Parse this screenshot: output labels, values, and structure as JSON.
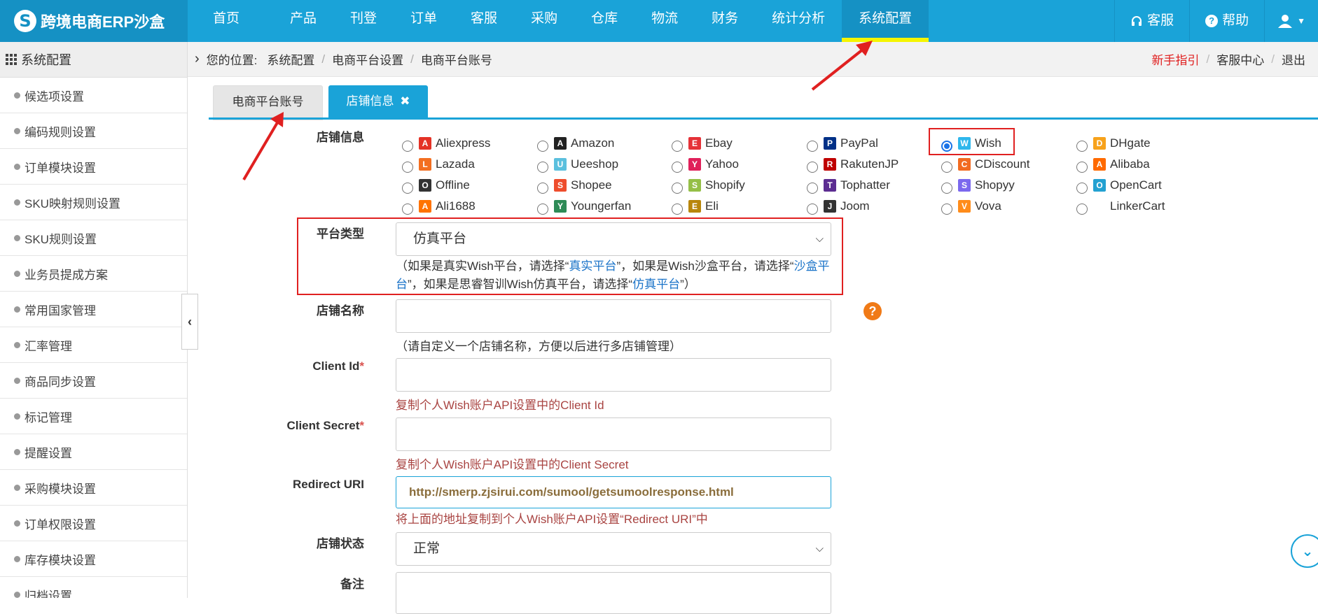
{
  "brand": {
    "logo_letter": "S",
    "name": "跨境电商ERP沙盒"
  },
  "topnav": {
    "items": [
      "首页",
      "产品",
      "刊登",
      "订单",
      "客服",
      "采购",
      "仓库",
      "物流",
      "财务",
      "统计分析",
      "系统配置"
    ],
    "active_index": 10,
    "right": {
      "service": "客服",
      "help": "帮助"
    }
  },
  "sidebar": {
    "title": "系统配置",
    "items": [
      "候选项设置",
      "编码规则设置",
      "订单模块设置",
      "SKU映射规则设置",
      "SKU规则设置",
      "业务员提成方案",
      "常用国家管理",
      "汇率管理",
      "商品同步设置",
      "标记管理",
      "提醒设置",
      "采购模块设置",
      "订单权限设置",
      "库存模块设置",
      "归档设置"
    ]
  },
  "breadcrumb": {
    "prefix": "您的位置:",
    "items": [
      "系统配置",
      "电商平台设置",
      "电商平台账号"
    ],
    "links": {
      "guide": "新手指引",
      "service_center": "客服中心",
      "logout": "退出"
    }
  },
  "tabs": {
    "tab1": "电商平台账号",
    "tab2": "店铺信息",
    "tab2_close": "✖"
  },
  "form": {
    "store_info_label": "店铺信息",
    "platforms": [
      {
        "name": "Aliexpress",
        "icon": "aliexpress-icon",
        "color": "#e43226"
      },
      {
        "name": "Amazon",
        "icon": "amazon-icon",
        "color": "#222222"
      },
      {
        "name": "Ebay",
        "icon": "ebay-icon",
        "color": "#e53238"
      },
      {
        "name": "PayPal",
        "icon": "paypal-icon",
        "color": "#003087"
      },
      {
        "name": "Wish",
        "icon": "wish-icon",
        "color": "#2fb7ec"
      },
      {
        "name": "DHgate",
        "icon": "dhgate-icon",
        "color": "#f7a21b"
      },
      {
        "name": "Lazada",
        "icon": "lazada-icon",
        "color": "#f36f21"
      },
      {
        "name": "Ueeshop",
        "icon": "ueeshop-icon",
        "color": "#5bc0de"
      },
      {
        "name": "Yahoo",
        "icon": "yahoo-icon",
        "color": "#e0205a"
      },
      {
        "name": "RakutenJP",
        "icon": "rakuten-icon",
        "color": "#bf0000"
      },
      {
        "name": "CDiscount",
        "icon": "cdiscount-icon",
        "color": "#f26b21"
      },
      {
        "name": "Alibaba",
        "icon": "alibaba-icon",
        "color": "#ff6a00"
      },
      {
        "name": "Offline",
        "icon": "offline-icon",
        "color": "#333333"
      },
      {
        "name": "Shopee",
        "icon": "shopee-icon",
        "color": "#ee4d2d"
      },
      {
        "name": "Shopify",
        "icon": "shopify-icon",
        "color": "#95bf47"
      },
      {
        "name": "Tophatter",
        "icon": "tophatter-icon",
        "color": "#5c2d91"
      },
      {
        "name": "Shopyy",
        "icon": "shopyy-icon",
        "color": "#7b68ee"
      },
      {
        "name": "OpenCart",
        "icon": "opencart-icon",
        "color": "#23a1d1"
      },
      {
        "name": "Ali1688",
        "icon": "ali1688-icon",
        "color": "#ff7300"
      },
      {
        "name": "Youngerfan",
        "icon": "youngerfan-icon",
        "color": "#2e8b57"
      },
      {
        "name": "Eli",
        "icon": "eli-icon",
        "color": "#b8860b"
      },
      {
        "name": "Joom",
        "icon": "joom-icon",
        "color": "#333333"
      },
      {
        "name": "Vova",
        "icon": "vova-icon",
        "color": "#ff8c1a"
      },
      {
        "name": "LinkerCart",
        "icon": "",
        "color": ""
      }
    ],
    "selected_platform": "Wish",
    "platform_type_label": "平台类型",
    "platform_type_value": "仿真平台",
    "platform_type_hint": {
      "p1": "（如果是真实Wish平台，请选择“",
      "l1": "真实平台",
      "p2": "”，如果是Wish沙盒平台，请选择“",
      "l2": "沙盒平台",
      "p3": "”，如果是思睿智训Wish仿真平台，请选择“",
      "l3": "仿真平台",
      "p4": "”）"
    },
    "store_name_label": "店铺名称",
    "store_name_value": "",
    "store_name_hint": "（请自定义一个店铺名称，方便以后进行多店铺管理）",
    "client_id_label": "Client Id",
    "client_id_value": "",
    "client_id_hint": "复制个人Wish账户API设置中的Client Id",
    "client_secret_label": "Client Secret",
    "client_secret_value": "",
    "client_secret_hint": "复制个人Wish账户API设置中的Client Secret",
    "redirect_label": "Redirect URI",
    "redirect_value": "http://smerp.zjsirui.com/sumool/getsumoolresponse.html",
    "redirect_hint": "将上面的地址复制到个人Wish账户API设置“Redirect URI”中",
    "status_label": "店铺状态",
    "status_value": "正常",
    "remark_label": "备注",
    "required_mark": "*"
  },
  "colors": {
    "primary": "#1aa3d8",
    "active_tab_bg": "#1591c4",
    "active_underline": "#f5f500",
    "highlight_red": "#e02020",
    "hint_red": "#a94442",
    "link_blue": "#1a73c8"
  }
}
